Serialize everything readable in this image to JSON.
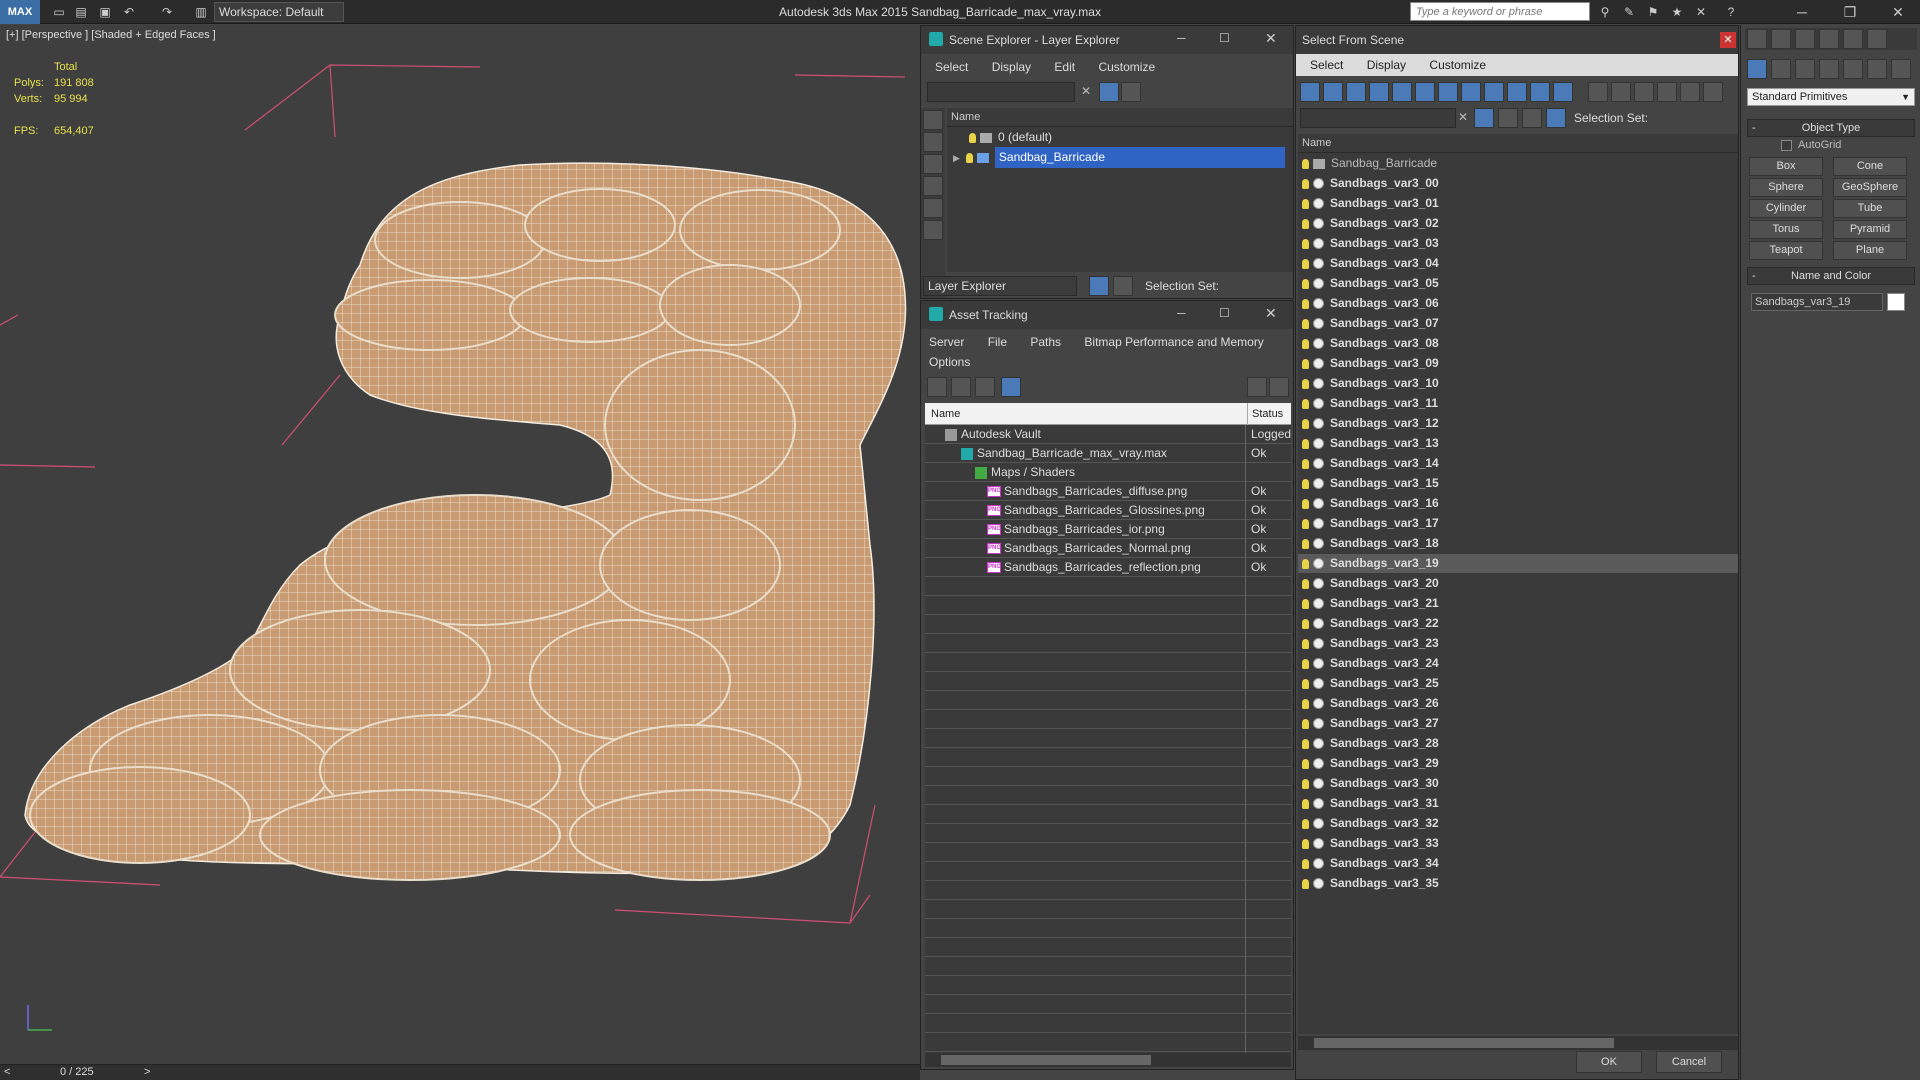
{
  "app": {
    "logo": "MAX",
    "workspace": "Workspace: Default",
    "title": "Autodesk 3ds Max  2015    Sandbag_Barricade_max_vray.max",
    "search_placeholder": "Type a keyword or phrase"
  },
  "viewport": {
    "label": "[+] [Perspective ] [Shaded + Edged Faces ]",
    "stats_header": "Total",
    "polys_label": "Polys:",
    "polys_value": "191 808",
    "verts_label": "Verts:",
    "verts_value": "95 994",
    "fps_label": "FPS:",
    "fps_value": "654,407",
    "mesh_color": "#c89b72"
  },
  "timeline": {
    "frame": "0 / 225",
    "prev": "<",
    "next": ">"
  },
  "layer_explorer": {
    "title": "Scene Explorer - Layer Explorer",
    "menu": [
      "Select",
      "Display",
      "Edit",
      "Customize"
    ],
    "col_name": "Name",
    "layers": [
      "0 (default)",
      "Sandbag_Barricade"
    ],
    "footer_dropdown": "Layer Explorer",
    "selection_set": "Selection Set:"
  },
  "asset_tracking": {
    "title": "Asset Tracking",
    "menu": [
      "Server",
      "File",
      "Paths",
      "Bitmap Performance and Memory"
    ],
    "menu2": "Options",
    "col_name": "Name",
    "col_status": "Status",
    "rows": [
      {
        "name": "Autodesk Vault",
        "status": "Logged"
      },
      {
        "name": "Sandbag_Barricade_max_vray.max",
        "status": "Ok"
      },
      {
        "name": "Maps / Shaders",
        "status": ""
      },
      {
        "name": "Sandbags_Barricades_diffuse.png",
        "status": "Ok"
      },
      {
        "name": "Sandbags_Barricades_Glossines.png",
        "status": "Ok"
      },
      {
        "name": "Sandbags_Barricades_ior.png",
        "status": "Ok"
      },
      {
        "name": "Sandbags_Barricades_Normal.png",
        "status": "Ok"
      },
      {
        "name": "Sandbags_Barricades_reflection.png",
        "status": "Ok"
      }
    ]
  },
  "select_from_scene": {
    "title": "Select From Scene",
    "menu": [
      "Select",
      "Display",
      "Customize"
    ],
    "selection_set": "Selection Set:",
    "col_name": "Name",
    "root": "Sandbag_Barricade",
    "items": [
      "Sandbags_var3_00",
      "Sandbags_var3_01",
      "Sandbags_var3_02",
      "Sandbags_var3_03",
      "Sandbags_var3_04",
      "Sandbags_var3_05",
      "Sandbags_var3_06",
      "Sandbags_var3_07",
      "Sandbags_var3_08",
      "Sandbags_var3_09",
      "Sandbags_var3_10",
      "Sandbags_var3_11",
      "Sandbags_var3_12",
      "Sandbags_var3_13",
      "Sandbags_var3_14",
      "Sandbags_var3_15",
      "Sandbags_var3_16",
      "Sandbags_var3_17",
      "Sandbags_var3_18",
      "Sandbags_var3_19",
      "Sandbags_var3_20",
      "Sandbags_var3_21",
      "Sandbags_var3_22",
      "Sandbags_var3_23",
      "Sandbags_var3_24",
      "Sandbags_var3_25",
      "Sandbags_var3_26",
      "Sandbags_var3_27",
      "Sandbags_var3_28",
      "Sandbags_var3_29",
      "Sandbags_var3_30",
      "Sandbags_var3_31",
      "Sandbags_var3_32",
      "Sandbags_var3_33",
      "Sandbags_var3_34",
      "Sandbags_var3_35"
    ],
    "selected_item": "Sandbags_var3_19",
    "ok": "OK",
    "cancel": "Cancel"
  },
  "command_panel": {
    "dropdown": "Standard Primitives",
    "object_type": "Object Type",
    "autogrid": "AutoGrid",
    "buttons": [
      "Box",
      "Cone",
      "Sphere",
      "GeoSphere",
      "Cylinder",
      "Tube",
      "Torus",
      "Pyramid",
      "Teapot",
      "Plane"
    ],
    "name_and_color": "Name and Color",
    "object_name": "Sandbags_var3_19",
    "object_color": "#ffffff"
  }
}
